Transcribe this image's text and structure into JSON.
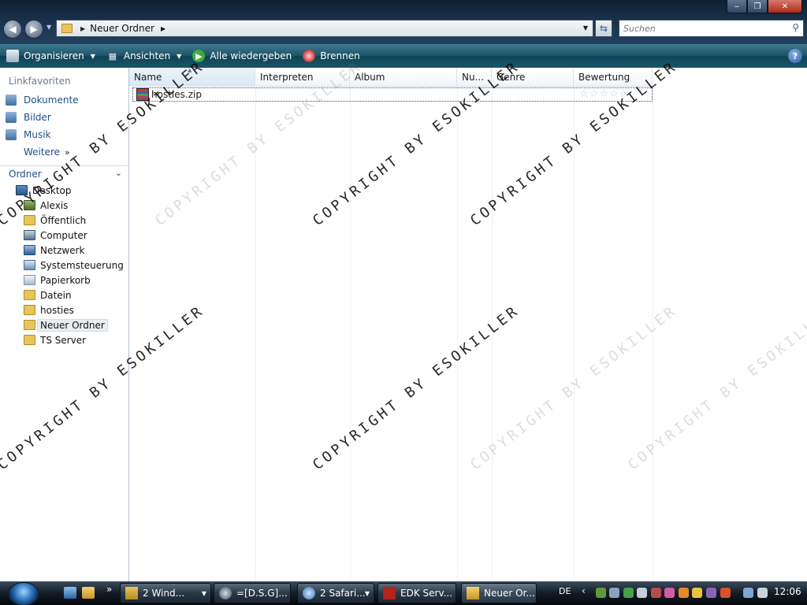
{
  "window": {
    "minimize": "‒",
    "maximize": "❐",
    "close": "✕"
  },
  "address": {
    "breadcrumb": "Neuer Ordner",
    "search_placeholder": "Suchen"
  },
  "toolbar": {
    "organize": "Organisieren",
    "views": "Ansichten",
    "play_all": "Alle wiedergeben",
    "burn": "Brennen",
    "help": "?"
  },
  "navpane": {
    "favorites_title": "Linkfavoriten",
    "favorites": [
      {
        "label": "Dokumente",
        "icon": "documents-icon"
      },
      {
        "label": "Bilder",
        "icon": "pictures-icon"
      },
      {
        "label": "Musik",
        "icon": "music-icon"
      },
      {
        "label": "Weitere",
        "icon": "more-icon"
      }
    ],
    "folders_title": "Ordner",
    "tree": [
      {
        "label": "Desktop",
        "icon": "desktop-icon",
        "indent": 0
      },
      {
        "label": "Alexis",
        "icon": "user-icon",
        "indent": 1
      },
      {
        "label": "Öffentlich",
        "icon": "folder-icon",
        "indent": 1
      },
      {
        "label": "Computer",
        "icon": "computer-icon",
        "indent": 1
      },
      {
        "label": "Netzwerk",
        "icon": "network-icon",
        "indent": 1
      },
      {
        "label": "Systemsteuerung",
        "icon": "control-panel-icon",
        "indent": 1
      },
      {
        "label": "Papierkorb",
        "icon": "recycle-bin-icon",
        "indent": 1
      },
      {
        "label": "Datein",
        "icon": "folder-icon",
        "indent": 1
      },
      {
        "label": "hosties",
        "icon": "folder-icon",
        "indent": 1
      },
      {
        "label": "Neuer Ordner",
        "icon": "folder-icon",
        "indent": 1,
        "selected": true
      },
      {
        "label": "TS Server",
        "icon": "folder-icon",
        "indent": 1
      }
    ]
  },
  "filelist": {
    "columns": [
      "Name",
      "Interpreten",
      "Album",
      "Nu...",
      "Genre",
      "Bewertung"
    ],
    "files": [
      {
        "name": "hosties.zip",
        "icon": "zip-archive-icon",
        "rating": 0,
        "rating_max": 5
      }
    ]
  },
  "watermark": "COPYRIGHT BY ESOKILLER",
  "taskbar": {
    "buttons": [
      {
        "label": "2 Wind...",
        "icon": "explorer-icon"
      },
      {
        "label": "=[D.S.G]...",
        "icon": "steam-icon"
      },
      {
        "label": "2 Safari...",
        "icon": "safari-icon"
      },
      {
        "label": "EDK Serv...",
        "icon": "filezilla-icon"
      },
      {
        "label": "Neuer Or...",
        "icon": "folder-icon",
        "active": true
      }
    ],
    "language": "DE",
    "clock": "12:06"
  },
  "colors": {
    "accent": "#1f4e8c",
    "cmdbar": "#1e5368",
    "folder": "#e8c45b"
  }
}
